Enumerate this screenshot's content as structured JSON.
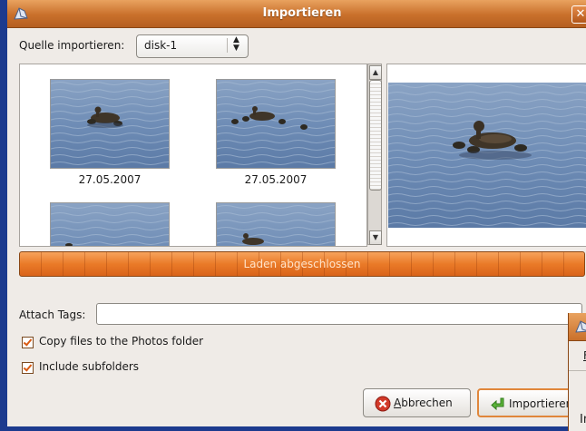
{
  "window": {
    "title": "Importieren",
    "close_glyph": "✕"
  },
  "source": {
    "label": "Quelle importieren:",
    "selected": "disk-1"
  },
  "thumbnails": [
    {
      "date": "27.05.2007"
    },
    {
      "date": "27.05.2007"
    },
    {
      "date": ""
    },
    {
      "date": ""
    }
  ],
  "progress": {
    "text": "Laden abgeschlossen",
    "value": 1.0
  },
  "tags": {
    "label": "Attach Tags:",
    "value": ""
  },
  "options": {
    "copy_label": "Copy files to the Photos folder",
    "copy_checked": true,
    "subfolders_label": "Include subfolders",
    "subfolders_checked": true
  },
  "buttons": {
    "cancel_accel": "A",
    "cancel_rest": "bbrechen",
    "import_label": "Importieren"
  },
  "overlay_window": {
    "menu_accel": "F",
    "menu_rest": "i",
    "bottom_text": "In"
  },
  "icons": {
    "app": "f-spot-icon",
    "cancel": "cancel-icon",
    "import": "import-arrow-icon"
  },
  "colors": {
    "titlebar": "#c9702b",
    "progress": "#ea7a28",
    "desktop": "#1c3a8e"
  }
}
